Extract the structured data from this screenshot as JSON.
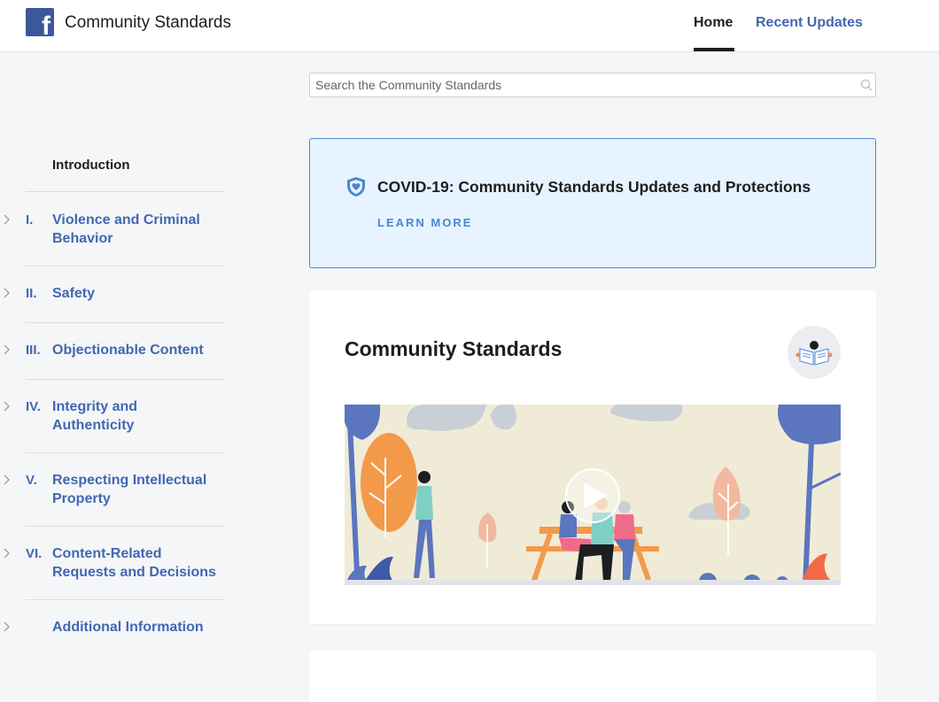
{
  "header": {
    "logo_letter": "f",
    "site_title": "Community Standards",
    "nav": {
      "home": "Home",
      "recent_updates": "Recent Updates"
    }
  },
  "search": {
    "placeholder": "Search the Community Standards"
  },
  "sidebar": {
    "intro": "Introduction",
    "items": [
      {
        "num": "I.",
        "label": "Violence and Criminal Behavior"
      },
      {
        "num": "II.",
        "label": "Safety"
      },
      {
        "num": "III.",
        "label": "Objectionable Content"
      },
      {
        "num": "IV.",
        "label": "Integrity and Authenticity"
      },
      {
        "num": "V.",
        "label": "Respecting Intellectual Property"
      },
      {
        "num": "VI.",
        "label": "Content-Related Requests and Decisions"
      },
      {
        "num": "",
        "label": "Additional Information"
      }
    ]
  },
  "covid_banner": {
    "title": "COVID-19: Community Standards Updates and Protections",
    "link": "LEARN MORE"
  },
  "main_card": {
    "title": "Community Standards"
  },
  "colors": {
    "brand": "#3b5998",
    "link": "#4267b2",
    "banner_bg": "#e7f3ff",
    "banner_border": "#4a86d4"
  }
}
